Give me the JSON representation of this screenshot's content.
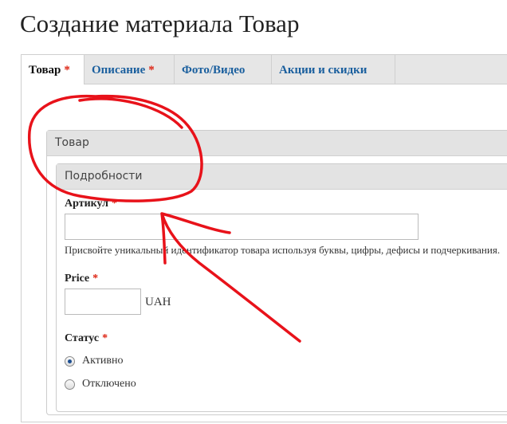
{
  "page": {
    "title": "Создание материала Товар"
  },
  "tabs": [
    {
      "label": "Товар",
      "required": "*",
      "active": true
    },
    {
      "label": "Описание",
      "required": "*",
      "active": false
    },
    {
      "label": "Фото/Видео",
      "required": "",
      "active": false
    },
    {
      "label": "Акции и скидки",
      "required": "",
      "active": false
    }
  ],
  "product_group": {
    "legend": "Товар",
    "details_group": {
      "legend": "Подробности",
      "sku": {
        "label": "Артикул",
        "required": "*",
        "value": "",
        "description": "Присвойте уникальный идентификатор товара используя буквы, цифры, дефисы и подчеркивания."
      },
      "price": {
        "label": "Price",
        "required": "*",
        "value": "",
        "suffix": "UAH"
      },
      "status": {
        "label": "Статус",
        "required": "*",
        "options": [
          {
            "label": "Активно",
            "checked": true
          },
          {
            "label": "Отключено",
            "checked": false
          }
        ]
      }
    }
  },
  "colors": {
    "tab_link": "#1a5f9e",
    "required_mark": "#dd2211",
    "annotation": "#e8121a"
  }
}
